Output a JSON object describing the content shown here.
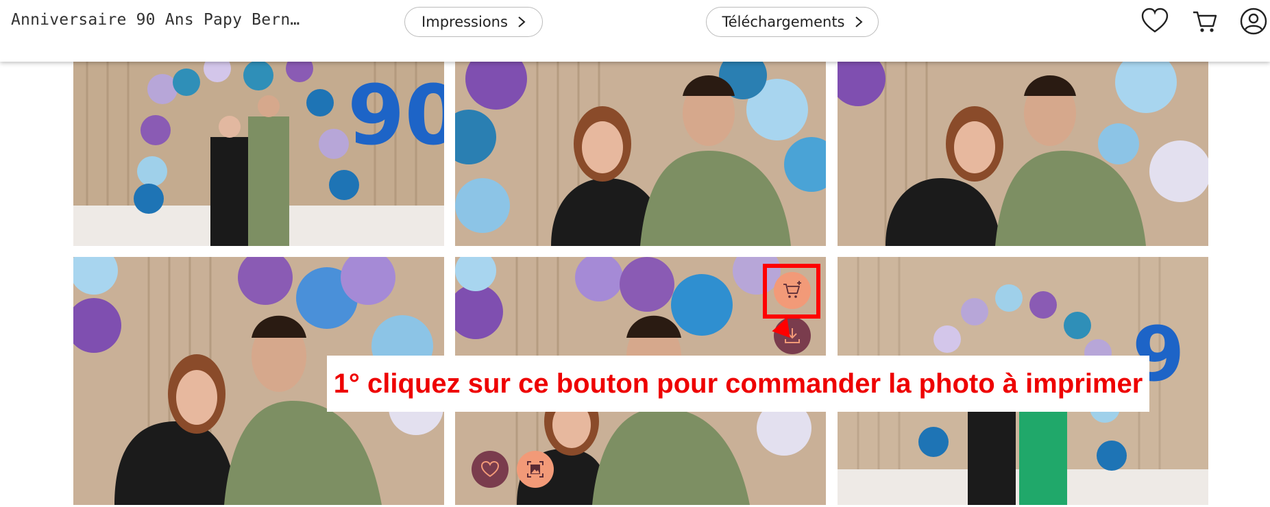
{
  "header": {
    "album_title": "Anniversaire 90 Ans Papy Bern…",
    "impressions_label": "Impressions",
    "downloads_label": "Téléchargements"
  },
  "icons": {
    "favorites": "heart-icon",
    "cart": "cart-icon",
    "account": "user-icon",
    "chevron": "chevron-right-icon",
    "add_to_cart": "cart-plus-icon",
    "download": "download-icon",
    "frame": "image-frame-icon"
  },
  "gallery": {
    "photos": [
      {
        "id": "photo-1"
      },
      {
        "id": "photo-2"
      },
      {
        "id": "photo-3"
      },
      {
        "id": "photo-4"
      },
      {
        "id": "photo-5"
      },
      {
        "id": "photo-6"
      }
    ]
  },
  "annotation": {
    "text": "1° cliquez sur ce bouton pour commander la photo à imprimer"
  },
  "colors": {
    "accent_peach": "#f29a78",
    "accent_plum": "#7a3c4d",
    "annotation_red": "#ee0000"
  }
}
